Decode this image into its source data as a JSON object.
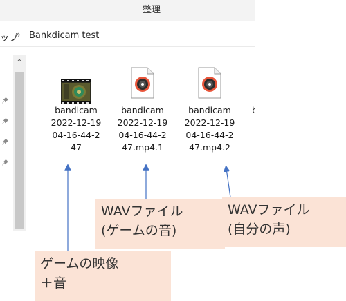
{
  "ribbon": {
    "tab_center_label": "整理"
  },
  "address": {
    "prev_crumb": "ップ",
    "separator": "›",
    "current_folder": "Bankdicam test"
  },
  "scrollbar": {
    "up_glyph": "^"
  },
  "files": [
    {
      "name": "bandicam\n2022-12-19\n04-16-44-2\n47",
      "icon": "video-thumbnail-icon"
    },
    {
      "name": "bandicam\n2022-12-19\n04-16-44-2\n47.mp4.1",
      "icon": "audio-file-icon"
    },
    {
      "name": "bandicam\n2022-12-19\n04-16-44-2\n47.mp4.2",
      "icon": "audio-file-icon"
    }
  ],
  "cutoff_text": "b",
  "callouts": {
    "wav_game": "WAVファイル\n(ゲームの音)",
    "wav_voice": "WAVファイル\n(自分の声)",
    "video": "ゲームの映像\n＋音"
  },
  "colors": {
    "callout_bg": "#fbe3d6",
    "arrow": "#4472c4",
    "scrollbar_thumb": "#c8c8c8"
  }
}
